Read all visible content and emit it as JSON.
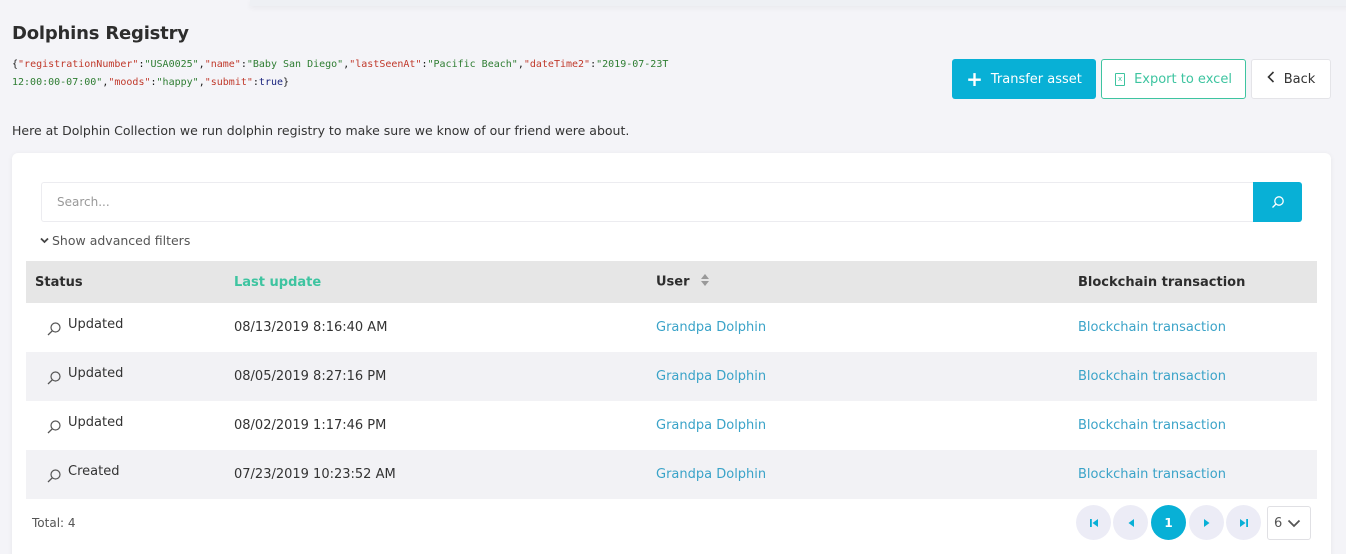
{
  "header": {
    "title": "Dolphins Registry",
    "json_parts": [
      {
        "t": "{",
        "c": "p"
      },
      {
        "t": "\"registrationNumber\"",
        "c": "k"
      },
      {
        "t": ":",
        "c": "p"
      },
      {
        "t": "\"USA0025\"",
        "c": "s"
      },
      {
        "t": ",",
        "c": "p"
      },
      {
        "t": "\"name\"",
        "c": "k"
      },
      {
        "t": ":",
        "c": "p"
      },
      {
        "t": "\"Baby San Diego\"",
        "c": "s"
      },
      {
        "t": ",",
        "c": "p"
      },
      {
        "t": "\"lastSeenAt\"",
        "c": "k"
      },
      {
        "t": ":",
        "c": "p"
      },
      {
        "t": "\"Pacific Beach\"",
        "c": "s"
      },
      {
        "t": ",",
        "c": "p"
      },
      {
        "t": "\"dateTime2\"",
        "c": "k"
      },
      {
        "t": ":",
        "c": "p"
      },
      {
        "t": "\"2019-07-23T12:00:00-07:00\"",
        "c": "s"
      },
      {
        "t": ",",
        "c": "p"
      },
      {
        "t": "\"moods\"",
        "c": "k"
      },
      {
        "t": ":",
        "c": "p"
      },
      {
        "t": "\"happy\"",
        "c": "s"
      },
      {
        "t": ",",
        "c": "p"
      },
      {
        "t": "\"submit\"",
        "c": "k"
      },
      {
        "t": ":",
        "c": "p"
      },
      {
        "t": "true",
        "c": "b"
      },
      {
        "t": "}",
        "c": "p"
      }
    ],
    "intro": "Here at Dolphin Collection we run dolphin registry to make sure we know of our friend were about."
  },
  "toolbar": {
    "transfer_label": "Transfer asset",
    "export_label": "Export to excel",
    "back_label": "Back"
  },
  "search": {
    "placeholder": "Search...",
    "advanced_label": "Show advanced filters"
  },
  "table": {
    "columns": [
      "Status",
      "Last update",
      "User",
      "Blockchain transaction"
    ],
    "rows": [
      {
        "status": "Updated",
        "date": "08/13/2019 8:16:40 AM",
        "user": "Grandpa Dolphin",
        "tx": "Blockchain transaction"
      },
      {
        "status": "Updated",
        "date": "08/05/2019 8:27:16 PM",
        "user": "Grandpa Dolphin",
        "tx": "Blockchain transaction"
      },
      {
        "status": "Updated",
        "date": "08/02/2019 1:17:46 PM",
        "user": "Grandpa Dolphin",
        "tx": "Blockchain transaction"
      },
      {
        "status": "Created",
        "date": "07/23/2019 10:23:52 AM",
        "user": "Grandpa Dolphin",
        "tx": "Blockchain transaction"
      }
    ]
  },
  "footer": {
    "total": "Total: 4",
    "current_page": "1",
    "page_size": "6"
  },
  "colors": {
    "accent": "#08b0d6",
    "success": "#3ec4a0",
    "link": "#3aa3c8"
  }
}
